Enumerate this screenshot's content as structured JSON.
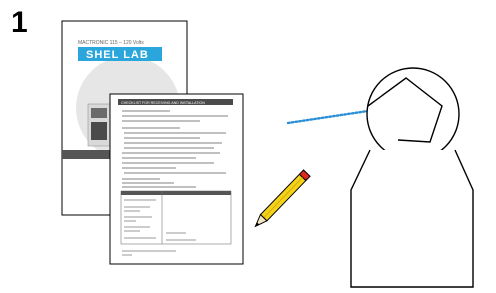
{
  "step": {
    "number": "1"
  },
  "manual": {
    "model_text": "MACTRONIC 115 – 120 Volts",
    "brand_text": "SHEL LAB",
    "colors": {
      "brand_blue": "#2aa6dd",
      "page_gray": "#e6e6e6",
      "band_dark": "#555555"
    }
  },
  "sheet": {
    "header_text": "CHECKLIST FOR RECEIVING AND INSTALLATION",
    "colors": {
      "header_fill": "#4a4a4a",
      "line_gray": "#9a9a9a"
    }
  },
  "pencil": {
    "colors": {
      "body": "#f5d21a",
      "outline": "#000000",
      "tip_red": "#e0281e"
    }
  },
  "gaze": {
    "colors": {
      "dots": "#2a8fd6"
    }
  },
  "icons": {
    "manual": "manual-document-icon",
    "checklist": "checklist-sheet-icon",
    "pencil": "pencil-icon",
    "person": "person-reading-icon"
  }
}
